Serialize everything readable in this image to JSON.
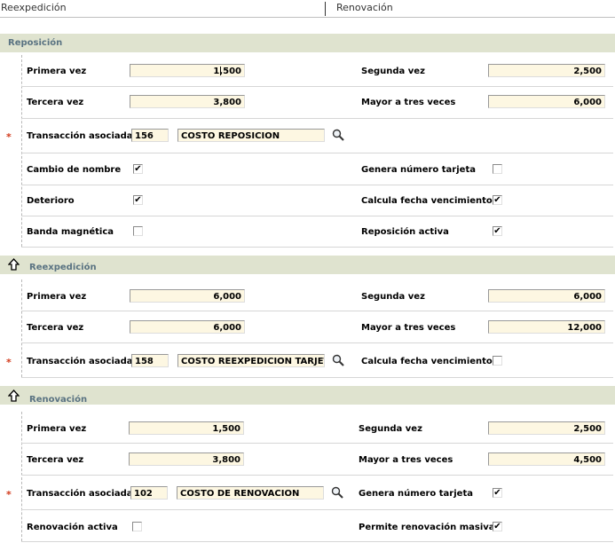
{
  "tabs": {
    "left": "Reexpedición",
    "right": "Renovación"
  },
  "reposicion": {
    "title": "Reposición",
    "primera_vez_label": "Primera vez",
    "primera_vez": "1,500",
    "segunda_vez_label": "Segunda vez",
    "segunda_vez": "2,500",
    "tercera_vez_label": "Tercera vez",
    "tercera_vez": "3,800",
    "mayor_label": "Mayor a tres veces",
    "mayor": "6,000",
    "transaccion_label": "Transacción asociada",
    "transaccion_code": "156",
    "transaccion_desc": "COSTO REPOSICION",
    "cambio_nombre_label": "Cambio de nombre",
    "cambio_nombre": true,
    "genera_label": "Genera número tarjeta",
    "genera": false,
    "deterioro_label": "Deterioro",
    "deterioro": true,
    "calcula_label": "Calcula fecha vencimiento",
    "calcula": true,
    "banda_label": "Banda magnética",
    "banda": false,
    "activa_label": "Reposición activa",
    "activa": true
  },
  "reexpedicion": {
    "title": "Reexpedición",
    "primera_vez_label": "Primera vez",
    "primera_vez": "6,000",
    "segunda_vez_label": "Segunda vez",
    "segunda_vez": "6,000",
    "tercera_vez_label": "Tercera vez",
    "tercera_vez": "6,000",
    "mayor_label": "Mayor a tres veces",
    "mayor": "12,000",
    "transaccion_label": "Transacción asociada",
    "transaccion_code": "158",
    "transaccion_desc": "COSTO REEXPEDICION TARJETA",
    "calcula_label": "Calcula fecha vencimiento",
    "calcula": false
  },
  "renovacion": {
    "title": "Renovación",
    "primera_vez_label": "Primera vez",
    "primera_vez": "1,500",
    "segunda_vez_label": "Segunda vez",
    "segunda_vez": "2,500",
    "tercera_vez_label": "Tercera vez",
    "tercera_vez": "3,800",
    "mayor_label": "Mayor a tres veces",
    "mayor": "4,500",
    "transaccion_label": "Transacción asociada",
    "transaccion_code": "102",
    "transaccion_desc": "COSTO DE RENOVACION",
    "genera_label": "Genera número tarjeta",
    "genera": true,
    "activa_label": "Renovación activa",
    "activa": false,
    "masiva_label": "Permite renovación masiva",
    "masiva": true
  },
  "required_marker": "*",
  "icons": {
    "search": "magnifier-icon",
    "collapse": "up-arrow-icon"
  },
  "colors": {
    "section_bg": "#dfe3cf",
    "section_title": "#5a7382",
    "input_bg": "#fdf7e2",
    "required": "#d23a1b"
  }
}
